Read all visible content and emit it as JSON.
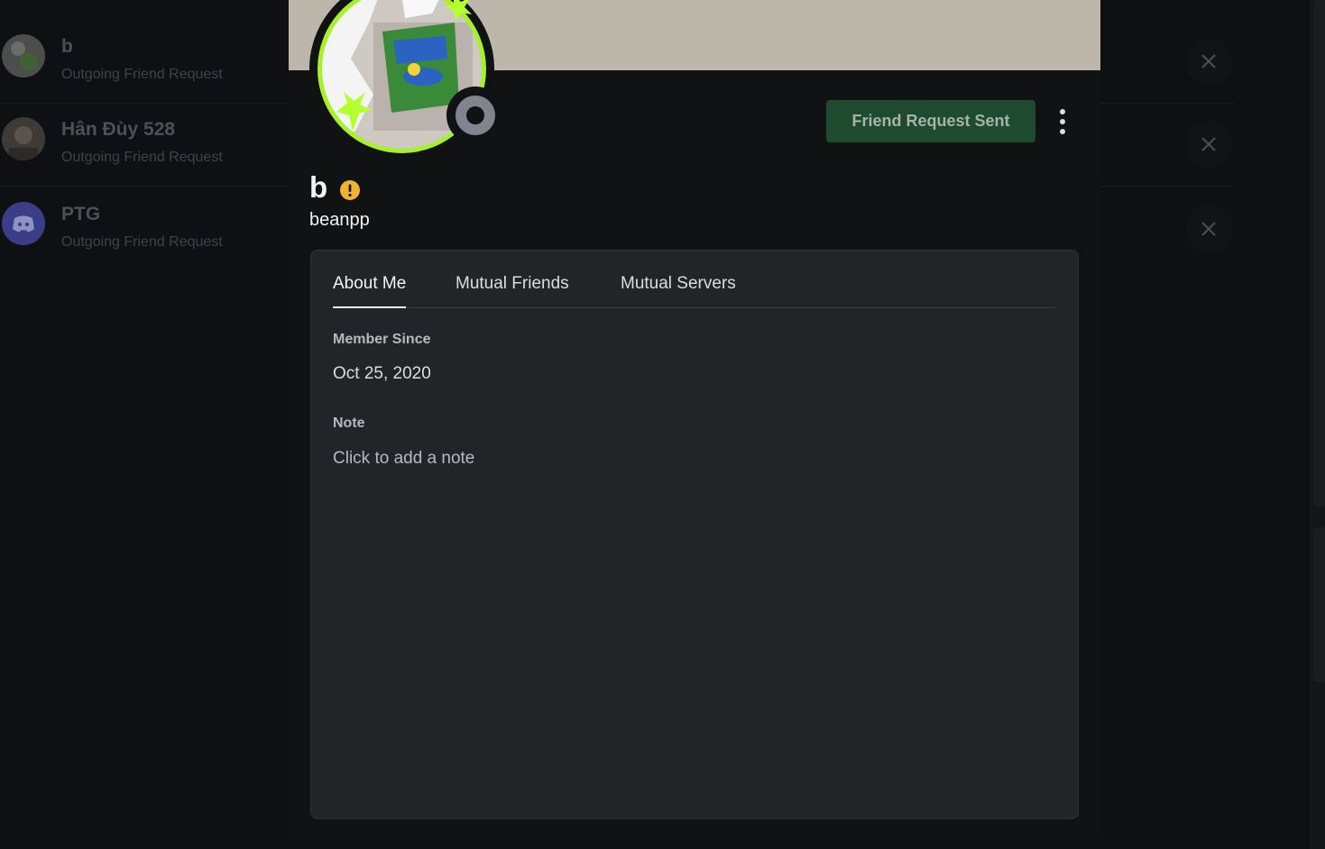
{
  "background_list": {
    "rows": [
      {
        "name": "b",
        "subtitle": "Outgoing Friend Request",
        "avatar_icon": "user-photo-avatar"
      },
      {
        "name": "Hân Đùy 528",
        "subtitle": "Outgoing Friend Request",
        "avatar_icon": "user-photo-avatar"
      },
      {
        "name": "PTG",
        "subtitle": "Outgoing Friend Request",
        "avatar_icon": "discord-logo-avatar"
      }
    ],
    "close_icon": "close-icon"
  },
  "profile": {
    "display_name": "b",
    "username": "beanpp",
    "status": "offline",
    "badge_icon": "warning-icon",
    "friend_button_label": "Friend Request Sent",
    "more_icon": "more-vertical-icon",
    "banner_color": "#bcb7aa",
    "accent_color": "#a6f22a"
  },
  "panel": {
    "tabs": [
      {
        "label": "About Me",
        "active": true
      },
      {
        "label": "Mutual Friends",
        "active": false
      },
      {
        "label": "Mutual Servers",
        "active": false
      }
    ],
    "member_since_label": "Member Since",
    "member_since_value": "Oct 25, 2020",
    "note_label": "Note",
    "note_placeholder": "Click to add a note"
  }
}
